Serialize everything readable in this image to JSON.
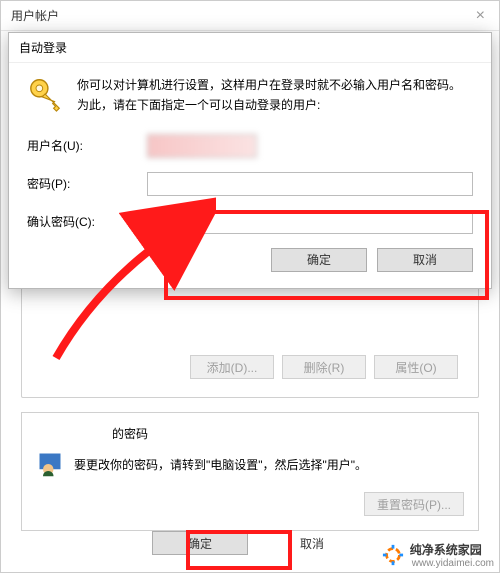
{
  "parent": {
    "title": "用户帐户",
    "close_glyph": "×",
    "buttons": {
      "add": "添加(D)...",
      "remove": "删除(R)",
      "properties": "属性(O)"
    },
    "pwd_section": {
      "header_suffix": "的密码",
      "text": "要更改你的密码，请转到\"电脑设置\"，然后选择\"用户\"。",
      "reset": "重置密码(P)..."
    },
    "bottom": {
      "ok": "确定",
      "cancel": "取消"
    }
  },
  "dialog": {
    "title": "自动登录",
    "info_line1": "你可以对计算机进行设置，这样用户在登录时就不必输入用户名和密码。",
    "info_line2": "为此，请在下面指定一个可以自动登录的用户:",
    "username_label": "用户名(U):",
    "password_label": "密码(P):",
    "confirm_label": "确认密码(C):",
    "ok": "确定",
    "cancel": "取消"
  },
  "watermark": {
    "text": "纯净系统家园",
    "url": "www.yidaimei.com"
  },
  "icons": {
    "key": "key-icon",
    "user": "user-icon",
    "close": "close-icon",
    "logo": "logo-icon"
  }
}
